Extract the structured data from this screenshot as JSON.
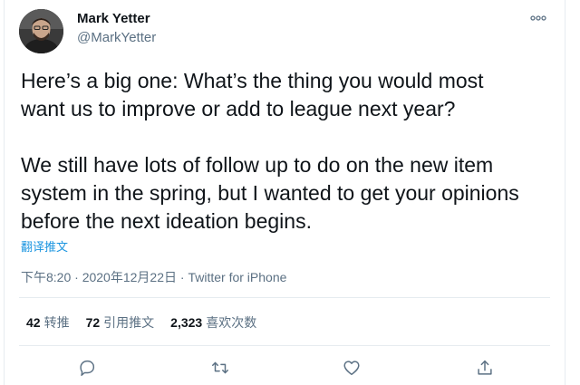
{
  "tweet": {
    "author_name": "Mark Yetter",
    "author_handle": "@MarkYetter",
    "paragraphs": [
      "Here’s a big one: What’s the thing you would most\nwant us to improve or add to league next year?",
      "We still have lots of follow up to do on the new item\nsystem in the spring, but I wanted to get your opinions\nbefore the next ideation begins."
    ],
    "translate_label": "翻译推文",
    "time": "下午8:20",
    "date": "2020年12月22日",
    "separator": "·",
    "source": "Twitter for iPhone"
  },
  "stats": {
    "retweets_count": "42",
    "retweets_label": "转推",
    "quotes_count": "72",
    "quotes_label": "引用推文",
    "likes_count": "2,323",
    "likes_label": "喜欢次数"
  },
  "icons": {
    "more": "more-icon",
    "reply": "reply-icon",
    "retweet": "retweet-icon",
    "like": "heart-icon",
    "share": "share-icon"
  },
  "colors": {
    "link": "#1b95e0",
    "secondary_text": "#5b7083",
    "primary_text": "#0f1419",
    "divider": "#e6ecf0"
  }
}
